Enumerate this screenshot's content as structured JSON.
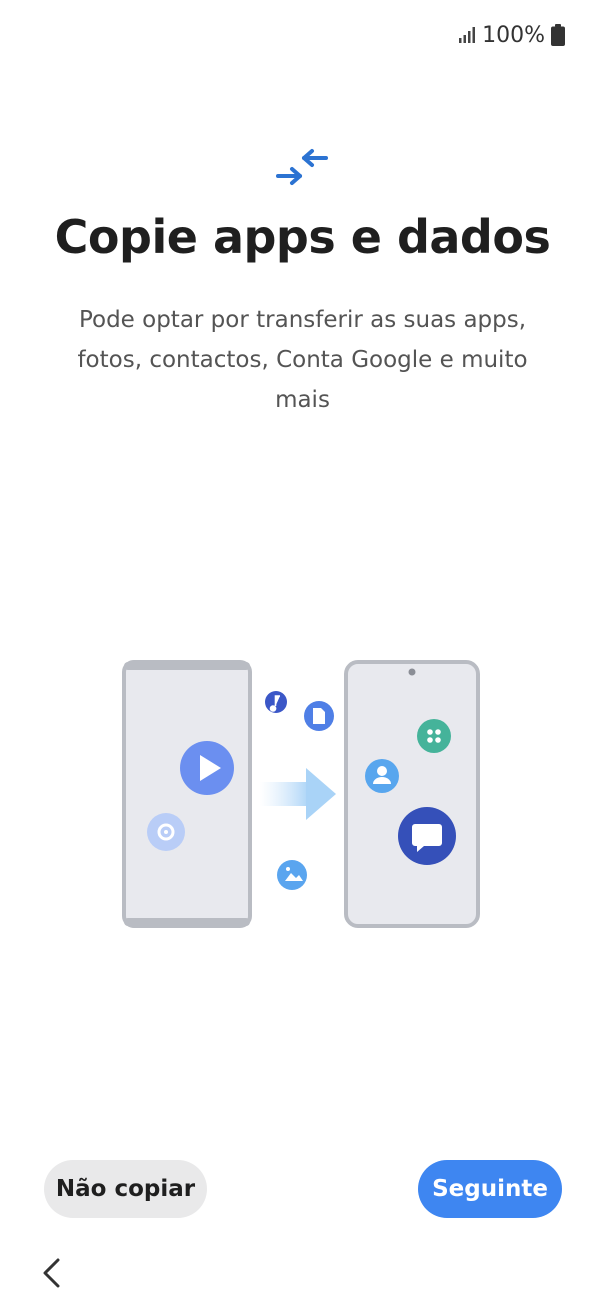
{
  "status_bar": {
    "battery_percent": "100%",
    "icons": [
      "signal-icon",
      "battery-icon"
    ]
  },
  "header": {
    "icon": "transfer-arrows-icon",
    "title": "Copie apps e dados",
    "subtitle": "Pode optar por transferir as suas apps, fotos, contactos, Conta Google e muito mais"
  },
  "illustration": {
    "icons": [
      "music-icon",
      "file-icon",
      "play-icon",
      "settings-icon",
      "image-icon",
      "apps-icon",
      "contact-icon",
      "message-icon",
      "transfer-arrow-icon"
    ]
  },
  "footer": {
    "skip_label": "Não copiar",
    "next_label": "Seguinte"
  },
  "navigation": {
    "back_icon": "back-chevron-icon"
  },
  "colors": {
    "accent": "#3e86f1",
    "secondary_button": "#e9e9ea",
    "title_text": "#1f1f1f",
    "body_text": "#545454"
  }
}
